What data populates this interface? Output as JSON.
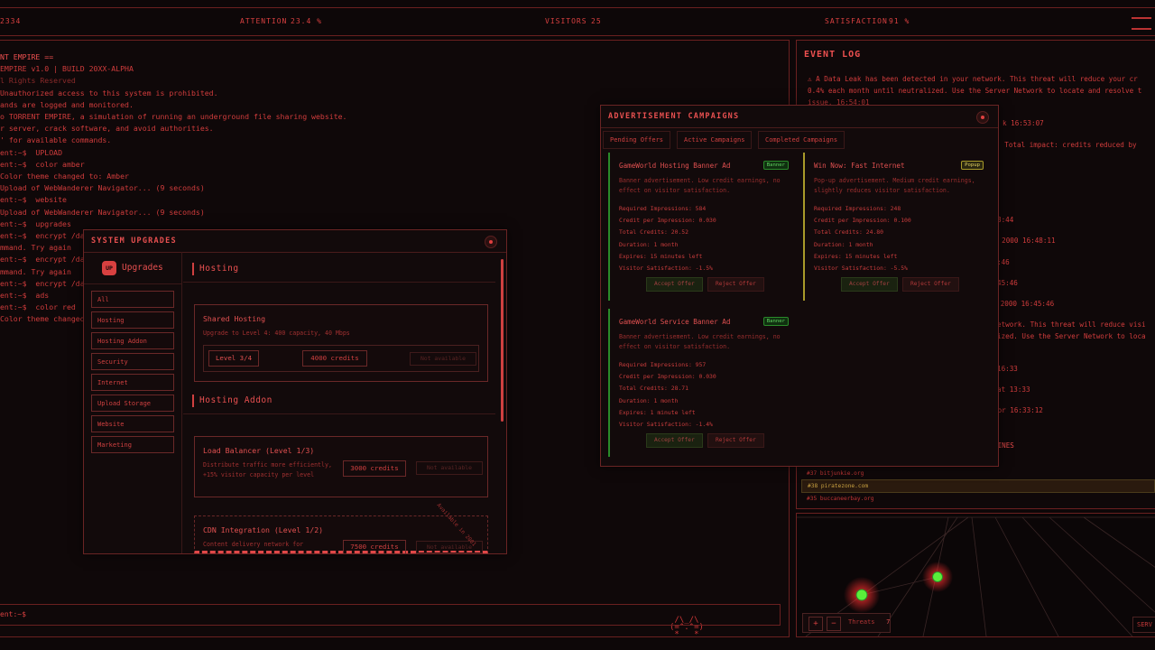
{
  "topbar": {
    "left_value": "2334",
    "attention_label": "ATTENTION",
    "attention_value": "23.4 %",
    "visitors_label": "VISITORS",
    "visitors_value": "25",
    "satisfaction_label": "SATISFACTION",
    "satisfaction_value": "91 %"
  },
  "terminal": {
    "lines": [
      "NT EMPIRE ==",
      "EMPIRE v1.0 | BUILD 20XX-ALPHA",
      "l Rights Reserved",
      "Unauthorized access to this system is prohibited.",
      "ands are logged and monitored.",
      "o TORRENT EMPIRE, a simulation of running an underground file sharing website.",
      "r server, crack software, and avoid authorities.",
      "' for available commands.",
      "ent:~$  UPLOAD",
      "ent:~$  color amber",
      "Color theme changed to: Amber",
      "Upload of WebWanderer Navigator... (9 seconds)",
      "ent:~$  website",
      "Upload of WebWanderer Navigator... (9 seconds)",
      "ent:~$  upgrades",
      "ent:~$  encrypt /dat",
      "mmand. Try again",
      "ent:~$  encrypt /dat",
      "mmand. Try again",
      "ent:~$  encrypt /dat",
      "ent:~$  ads",
      "ent:~$  color red",
      "Color theme changed"
    ],
    "prompt": "ent:~$"
  },
  "event_log": {
    "title": "EVENT LOG",
    "entries": [
      "⚠ A Data Leak has been detected in your network. This threat will reduce your cr",
      "0.4% each month until neutralized. Use the Server Network to locate and resolve t",
      "issue. 16:54:01",
      "k 16:53:07",
      "ly. Total impact: credits reduced by",
      "8:44",
      "y 2000 16:48:11",
      ":46",
      "45:46",
      "ty 2000 16:45:46",
      "etwork. This threat will reduce visi",
      "ized. Use the Server Network to loca",
      "16:33",
      "at 13:33",
      "tor 16:33:12",
      "GINES"
    ]
  },
  "sites": [
    "#37  bitjunkie.org",
    "#38  piratezone.com",
    "#35  buccaneerbay.org"
  ],
  "netmap": {
    "zoom_in": "+",
    "zoom_out": "−",
    "threats_label": "Threats",
    "threats_value": "7",
    "serv_label": "SERV"
  },
  "upgrades": {
    "title": "SYSTEM UPGRADES",
    "logo_badge": "UP",
    "logo_label": "Upgrades",
    "categories": [
      "All",
      "Hosting",
      "Hosting Addon",
      "Security",
      "Internet",
      "Upload Storage",
      "Website",
      "Marketing"
    ],
    "sections": {
      "hosting": "Hosting",
      "hosting_addon": "Hosting Addon"
    },
    "shared_hosting": {
      "title": "Shared Hosting",
      "desc": "Upgrade to Level 4: 400 capacity, 40 Mbps",
      "level": "Level 3/4",
      "cost": "4000 credits",
      "status": "Not available"
    },
    "load_balancer": {
      "title": "Load Balancer (Level 1/3)",
      "desc": "Distribute traffic more efficiently, +15% visitor capacity per level",
      "cost": "3000 credits",
      "status": "Not available"
    },
    "cdn": {
      "title": "CDN Integration (Level 1/2)",
      "desc": "Content delivery network for",
      "cost": "7500 credits",
      "status": "Not available",
      "ribbon": "Available in 2001"
    }
  },
  "ads": {
    "title": "ADVERTISEMENT CAMPAIGNS",
    "tabs": [
      "Pending Offers",
      "Active Campaigns",
      "Completed Campaigns"
    ],
    "labels": {
      "required": "Required Impressions:",
      "cpi": "Credit per Impression:",
      "total": "Total Credits:",
      "duration": "Duration:",
      "expires": "Expires:",
      "satisfaction": "Visitor Satisfaction:",
      "accept": "Accept Offer",
      "reject": "Reject Offer"
    },
    "offers": [
      {
        "title": "GameWorld Hosting Banner Ad",
        "tag": "Banner",
        "desc": "Banner advertisement. Low credit earnings, no effect on visitor satisfaction.",
        "required": "584",
        "cpi": "0.030",
        "total": "20.52",
        "duration": "1 month",
        "expires": "15 minutes left",
        "satisfaction": "-1.5%"
      },
      {
        "title": "Win Now: Fast Internet",
        "tag": "Popup",
        "desc": "Pop-up advertisement. Medium credit earnings, slightly reduces visitor satisfaction.",
        "required": "248",
        "cpi": "0.100",
        "total": "24.80",
        "duration": "1 month",
        "expires": "15 minutes left",
        "satisfaction": "-5.5%"
      },
      {
        "title": "GameWorld Service Banner Ad",
        "tag": "Banner",
        "desc": "Banner advertisement. Low credit earnings, no effect on visitor satisfaction.",
        "required": "957",
        "cpi": "0.030",
        "total": "28.71",
        "duration": "1 month",
        "expires": "1 minute left",
        "satisfaction": "-1.4%"
      }
    ]
  }
}
